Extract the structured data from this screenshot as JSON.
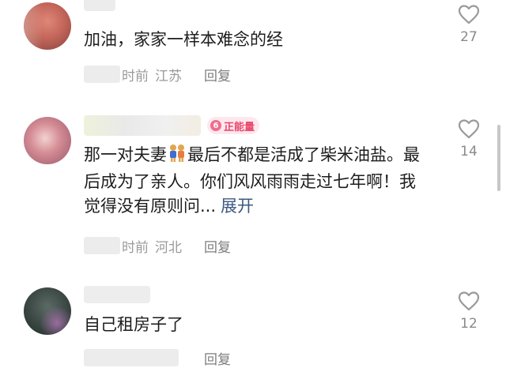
{
  "comments": [
    {
      "text": "加油，家家一样本难念的经",
      "time_suffix": "时前",
      "location": "江苏",
      "reply_label": "回复",
      "likes": "27"
    },
    {
      "badge_level": "6",
      "badge_text": "正能量",
      "text_before_emoji": "那一对夫妻",
      "text_after_emoji": "最后不都是活成了柴米油盐。最后成为了亲人。你们风风雨雨走过七年啊！我觉得没有原则问...",
      "expand_label": "展开",
      "time_suffix": "时前",
      "location": "河北",
      "reply_label": "回复",
      "likes": "14"
    },
    {
      "text": "自己租房子了",
      "likes": "12",
      "reply_label": "回复"
    }
  ],
  "colors": {
    "badge_bg": "#fde8ee",
    "badge_text": "#e8476b",
    "link": "#3d5a80",
    "meta": "#9a9a9a"
  }
}
